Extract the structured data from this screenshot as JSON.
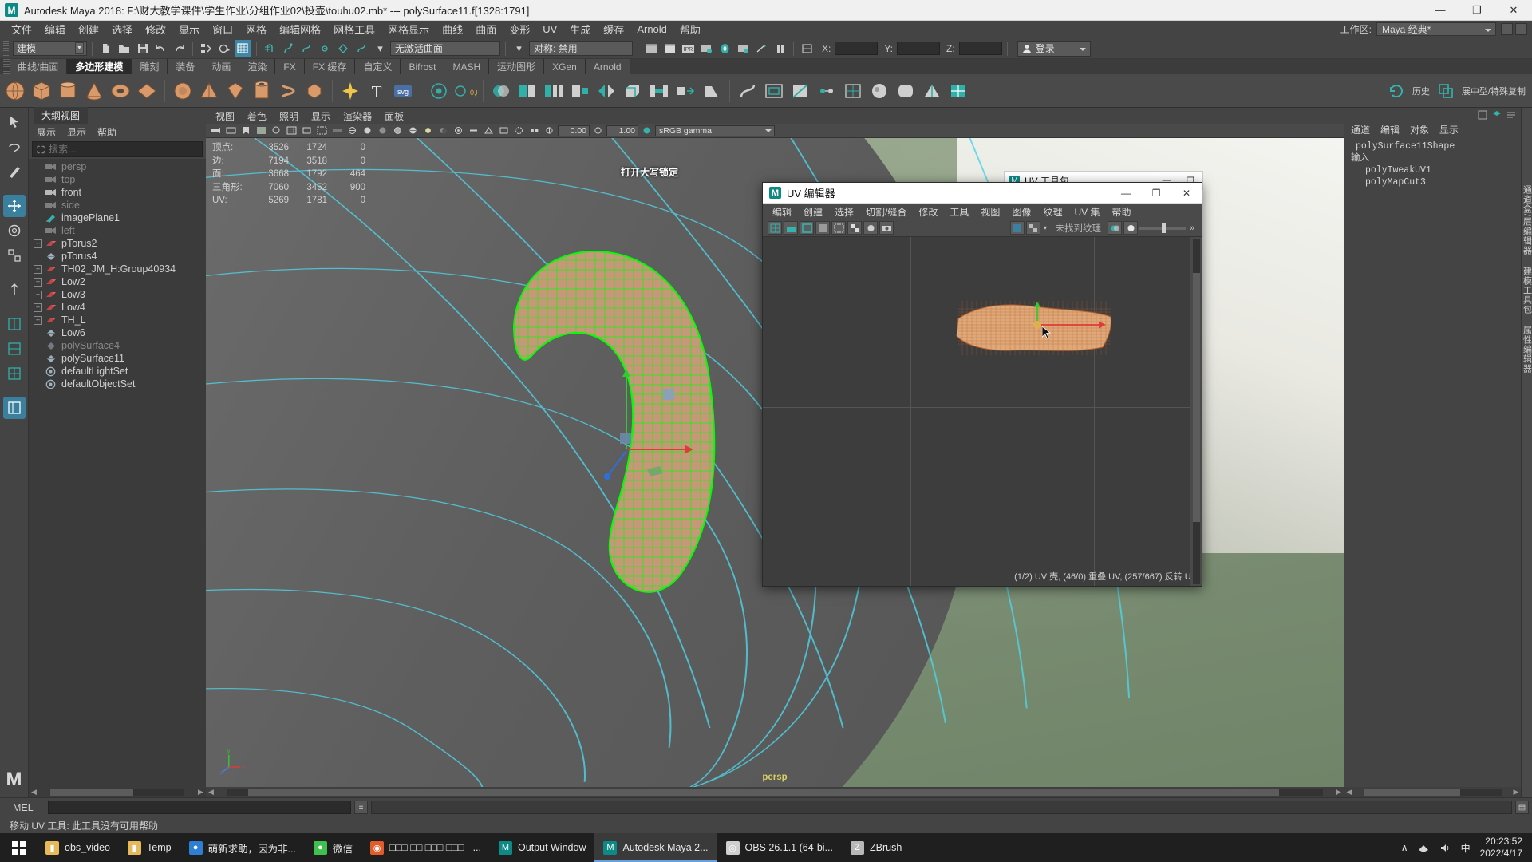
{
  "window": {
    "title": "Autodesk Maya 2018: F:\\财大教学课件\\学生作业\\分组作业02\\投壶\\touhu02.mb*   ---   polySurface11.f[1328:1791]",
    "logo": "M",
    "minimize": "—",
    "maximize": "❐",
    "close": "✕"
  },
  "menubar": {
    "items": [
      "文件",
      "编辑",
      "创建",
      "选择",
      "修改",
      "显示",
      "窗口",
      "网格",
      "编辑网格",
      "网格工具",
      "网格显示",
      "曲线",
      "曲面",
      "变形",
      "UV",
      "生成",
      "缓存",
      "Arnold",
      "帮助"
    ],
    "workspace_label": "工作区:",
    "workspace_value": "Maya 经典*"
  },
  "statusbar": {
    "mode": "建模",
    "surface_field": "无激活曲面",
    "symmetry_field": "对称: 禁用",
    "x_label": "X:",
    "y_label": "Y:",
    "z_label": "Z:",
    "x_value": "",
    "y_value": "",
    "z_value": "",
    "login_label": "登录"
  },
  "shelf": {
    "tabs": [
      "曲线/曲面",
      "多边形建模",
      "雕刻",
      "装备",
      "动画",
      "渲染",
      "FX",
      "FX 缓存",
      "自定义",
      "Bifrost",
      "MASH",
      "运动图形",
      "XGen",
      "Arnold"
    ],
    "active_tab": "多边形建模",
    "icon_labels": [
      "sphere",
      "cube",
      "cylinder",
      "cone",
      "torus",
      "plane",
      "soft-sphere",
      "pyramid",
      "sparkle",
      "text-T",
      "svg-badge",
      "target",
      "snap-045",
      "booleans",
      "combine",
      "separate",
      "extract",
      "mirror",
      "bevel",
      "bridge",
      "extrude",
      "wedge",
      "bend",
      "offset-edge",
      "multi-cut",
      "target-weld",
      "quad-draw",
      "sculpt",
      "smooth",
      "crease",
      "history",
      "special-dup"
    ],
    "history_label": "历史",
    "special_dup_label": "展中型/特殊复制"
  },
  "outliner": {
    "tab": "大纲视图",
    "menu": [
      "展示",
      "显示",
      "帮助"
    ],
    "search_placeholder": "搜索...",
    "items": [
      {
        "label": "persp",
        "icon": "camera-icon",
        "expandable": false,
        "dim": true
      },
      {
        "label": "top",
        "icon": "camera-icon",
        "expandable": false,
        "dim": true
      },
      {
        "label": "front",
        "icon": "camera-icon",
        "expandable": false,
        "dim": false
      },
      {
        "label": "side",
        "icon": "camera-icon",
        "expandable": false,
        "dim": true
      },
      {
        "label": "imagePlane1",
        "icon": "image-plane-icon",
        "expandable": false,
        "dim": false
      },
      {
        "label": "left",
        "icon": "camera-icon",
        "expandable": false,
        "dim": true
      },
      {
        "label": "pTorus2",
        "icon": "transform-icon",
        "expandable": true,
        "dim": false
      },
      {
        "label": "pTorus4",
        "icon": "mesh-icon",
        "expandable": false,
        "dim": false
      },
      {
        "label": "TH02_JM_H:Group40934",
        "icon": "transform-icon",
        "expandable": true,
        "dim": false
      },
      {
        "label": "Low2",
        "icon": "transform-icon",
        "expandable": true,
        "dim": false
      },
      {
        "label": "Low3",
        "icon": "transform-icon",
        "expandable": true,
        "dim": false
      },
      {
        "label": "Low4",
        "icon": "transform-icon",
        "expandable": true,
        "dim": false
      },
      {
        "label": "TH_L",
        "icon": "transform-icon",
        "expandable": true,
        "dim": false
      },
      {
        "label": "Low6",
        "icon": "mesh-icon",
        "expandable": false,
        "dim": false
      },
      {
        "label": "polySurface4",
        "icon": "mesh-icon",
        "expandable": false,
        "dim": true
      },
      {
        "label": "polySurface11",
        "icon": "mesh-icon",
        "expandable": false,
        "dim": false
      },
      {
        "label": "defaultLightSet",
        "icon": "set-icon",
        "expandable": false,
        "dim": false
      },
      {
        "label": "defaultObjectSet",
        "icon": "set-icon",
        "expandable": false,
        "dim": false
      }
    ]
  },
  "viewport": {
    "menu": [
      "视图",
      "着色",
      "照明",
      "显示",
      "渲染器",
      "面板"
    ],
    "exposure_value": "0.00",
    "gamma_value": "1.00",
    "color_profile": "sRGB gamma",
    "caps_lock_text": "打开大写锁定",
    "camera_label": "persp",
    "heads_up": {
      "columns": [
        "",
        "c1",
        "c2",
        "c3"
      ],
      "rows": [
        {
          "label": "顶点:",
          "v1": "3526",
          "v2": "1724",
          "v3": "0"
        },
        {
          "label": "边:",
          "v1": "7194",
          "v2": "3518",
          "v3": "0"
        },
        {
          "label": "面:",
          "v1": "3668",
          "v2": "1792",
          "v3": "464"
        },
        {
          "label": "三角形:",
          "v1": "7060",
          "v2": "3452",
          "v3": "900"
        },
        {
          "label": "UV:",
          "v1": "5269",
          "v2": "1781",
          "v3": "0"
        }
      ]
    }
  },
  "channelbox": {
    "menu": [
      "通道",
      "编辑",
      "对象",
      "显示"
    ],
    "shape_name": "polySurface11Shape",
    "inputs_label": "输入",
    "inputs": [
      "polyTweakUV1",
      "polyMapCut3"
    ]
  },
  "right_tabs": [
    "通道盒/层编辑器",
    "建模工具包",
    "属性编辑器"
  ],
  "uv_editor": {
    "title": "UV 编辑器",
    "logo": "M",
    "minimize": "—",
    "maximize": "❐",
    "close": "✕",
    "menu": [
      "编辑",
      "创建",
      "选择",
      "切割/缝合",
      "修改",
      "工具",
      "视图",
      "图像",
      "纹理",
      "UV 集",
      "帮助"
    ],
    "texture_status": "未找到纹理",
    "status_bar": "(1/2) UV 壳, (46/0) 重叠 UV, (257/667) 反转 UV"
  },
  "uv_tool_window": {
    "title": "UV 工具包",
    "minimize": "—",
    "maximize": "❐",
    "close": "✕"
  },
  "mel": {
    "label": "MEL",
    "input_value": "",
    "output_value": ""
  },
  "help_line": "移动 UV 工具: 此工具没有可用帮助",
  "taskbar": {
    "items": [
      {
        "label": "obs_video",
        "icon": "folder-icon",
        "color": "#e8b95a",
        "active": false
      },
      {
        "label": "Temp",
        "icon": "folder-icon",
        "color": "#e8b95a",
        "active": false
      },
      {
        "label": "萌新求助，因为非...",
        "icon": "browser-icon",
        "color": "#2e7fd4",
        "active": false
      },
      {
        "label": "微信",
        "icon": "wechat-icon",
        "color": "#3ec14f",
        "active": false
      },
      {
        "label": "□□□ □□ □□□ □□□ - ...",
        "icon": "media-icon",
        "color": "#e05c2b",
        "active": false
      },
      {
        "label": "Output Window",
        "icon": "maya-icon",
        "color": "#0e8a86",
        "active": false
      },
      {
        "label": "Autodesk Maya 2...",
        "icon": "maya-icon",
        "color": "#0e8a86",
        "active": true
      },
      {
        "label": "OBS 26.1.1 (64-bi...",
        "icon": "obs-icon",
        "color": "#cfcfcf",
        "active": false
      },
      {
        "label": "ZBrush",
        "icon": "zbrush-icon",
        "color": "#b8b8b8",
        "active": false
      }
    ],
    "tray": {
      "chevron": "∧",
      "network": "network-icon",
      "volume": "volume-icon",
      "ime": "中"
    },
    "time": "20:23:52",
    "date": "2022/4/17"
  },
  "colors": {
    "accent_teal": "#34b3ad",
    "selection_blue": "#3b7f9e",
    "mesh_green": "#00ff00",
    "uv_orange": "#e0a070",
    "taskbar_active": "#6aa0d8"
  }
}
